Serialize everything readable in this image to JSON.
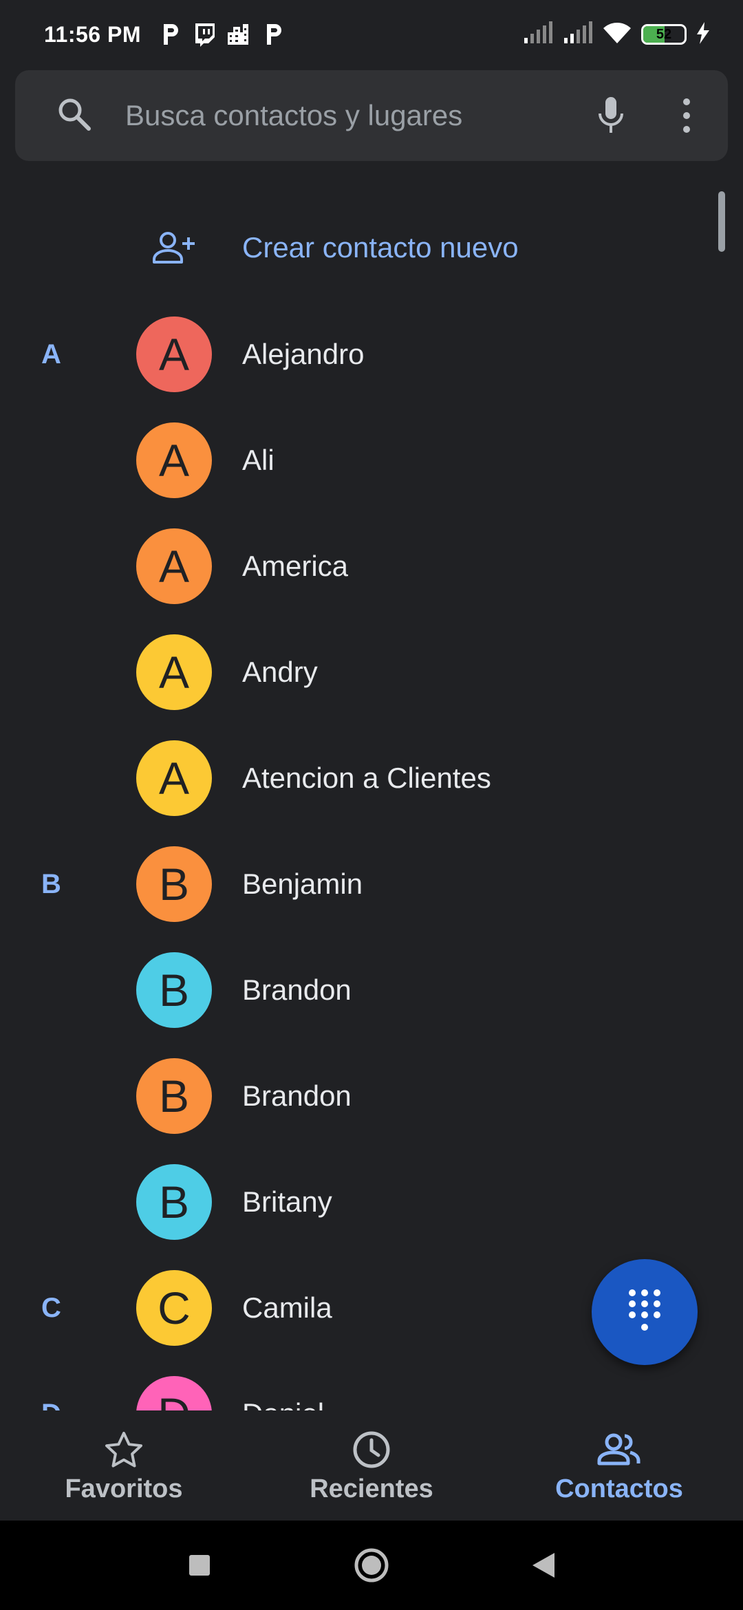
{
  "status_bar": {
    "time": "11:56 PM",
    "app_icons": [
      "p-app-icon",
      "twitch-icon",
      "buildings-app-icon",
      "p-app-icon"
    ],
    "battery_level": "52",
    "battery_level_percent": 52,
    "colors": {
      "battery_fill": "#4caf50"
    }
  },
  "search": {
    "placeholder": "Busca contactos y lugares",
    "icons": [
      "search-icon",
      "mic-icon",
      "more-vert-icon"
    ]
  },
  "create_contact": {
    "label": "Crear contacto nuevo",
    "icon": "add-person-icon"
  },
  "contacts": [
    {
      "section": "A",
      "initial": "A",
      "name": "Alejandro",
      "color": "#ee675c"
    },
    {
      "section": "",
      "initial": "A",
      "name": "Ali",
      "color": "#fa903e"
    },
    {
      "section": "",
      "initial": "A",
      "name": "America",
      "color": "#fa903e"
    },
    {
      "section": "",
      "initial": "A",
      "name": "Andry",
      "color": "#fcc934"
    },
    {
      "section": "",
      "initial": "A",
      "name": "Atencion a Clientes",
      "color": "#fcc934"
    },
    {
      "section": "B",
      "initial": "B",
      "name": "Benjamin",
      "color": "#fa903e"
    },
    {
      "section": "",
      "initial": "B",
      "name": "Brandon",
      "color": "#4ecde6"
    },
    {
      "section": "",
      "initial": "B",
      "name": "Brandon",
      "color": "#fa903e"
    },
    {
      "section": "",
      "initial": "B",
      "name": "Britany",
      "color": "#4ecde6"
    },
    {
      "section": "C",
      "initial": "C",
      "name": "Camila",
      "color": "#fcc934"
    },
    {
      "section": "D",
      "initial": "D",
      "name": "Daniel",
      "color": "#ff63b8"
    }
  ],
  "fab": {
    "icon": "dialpad-icon",
    "color": "#1a57c2"
  },
  "bottom_nav": {
    "tabs": [
      {
        "label": "Favoritos",
        "icon": "star-icon",
        "active": false
      },
      {
        "label": "Recientes",
        "icon": "clock-icon",
        "active": false
      },
      {
        "label": "Contactos",
        "icon": "contacts-icon",
        "active": true
      }
    ],
    "colors": {
      "active": "#8ab4f8",
      "inactive": "#bdc1c6"
    }
  },
  "system_nav": {
    "icons": [
      "recents-square-icon",
      "home-circle-icon",
      "back-triangle-icon"
    ]
  },
  "colors": {
    "background": "#202124",
    "surface": "#303134",
    "accent": "#8ab4f8"
  }
}
